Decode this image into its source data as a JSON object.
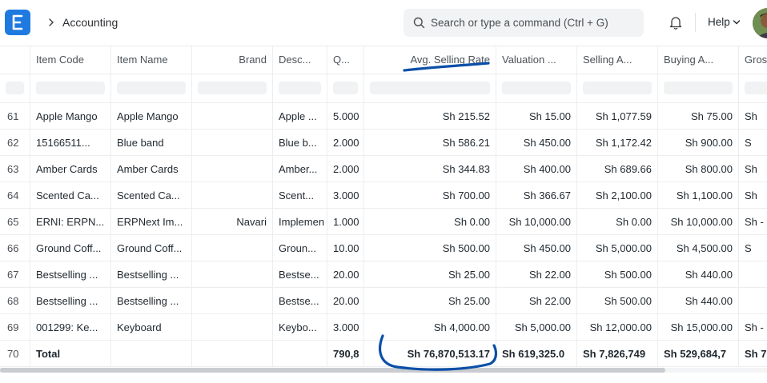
{
  "app": {
    "breadcrumb": "Accounting"
  },
  "search": {
    "placeholder": "Search or type a command (Ctrl + G)"
  },
  "help": {
    "label": "Help"
  },
  "colors": {
    "brand": "#1f7ae0",
    "annotation": "#0b4fa8"
  },
  "table": {
    "columns": [
      "Item Code",
      "Item Name",
      "Brand",
      "Desc...",
      "Q...",
      "Avg. Selling Rate",
      "Valuation ...",
      "Selling A...",
      "Buying A...",
      "Gros"
    ],
    "rows": [
      {
        "idx": "61",
        "code": "Apple Mango",
        "name": "Apple Mango",
        "brand": "",
        "desc": "Apple ...",
        "qty": "5.000",
        "avg": "Sh 215.52",
        "val": "Sh 15.00",
        "sell": "Sh 1,077.59",
        "buy": "Sh 75.00",
        "gross": "Sh"
      },
      {
        "idx": "62",
        "code": "15166511...",
        "name": "Blue band",
        "brand": "",
        "desc": "Blue b...",
        "qty": "2.000",
        "avg": "Sh 586.21",
        "val": "Sh 450.00",
        "sell": "Sh 1,172.42",
        "buy": "Sh 900.00",
        "gross": "S"
      },
      {
        "idx": "63",
        "code": "Amber Cards",
        "name": "Amber Cards",
        "brand": "",
        "desc": "Amber...",
        "qty": "2.000",
        "avg": "Sh 344.83",
        "val": "Sh 400.00",
        "sell": "Sh 689.66",
        "buy": "Sh 800.00",
        "gross": "Sh"
      },
      {
        "idx": "64",
        "code": "Scented Ca...",
        "name": "Scented Ca...",
        "brand": "",
        "desc": "Scent...",
        "qty": "3.000",
        "avg": "Sh 700.00",
        "val": "Sh 366.67",
        "sell": "Sh 2,100.00",
        "buy": "Sh 1,100.00",
        "gross": "Sh"
      },
      {
        "idx": "65",
        "code": "ERNI: ERPN...",
        "name": "ERPNext Im...",
        "brand": "Navari",
        "desc": "Implemen",
        "qty": "1.000",
        "avg": "Sh 0.00",
        "val": "Sh 10,000.00",
        "sell": "Sh 0.00",
        "buy": "Sh 10,000.00",
        "gross": "Sh -"
      },
      {
        "idx": "66",
        "code": "Ground Coff...",
        "name": "Ground Coff...",
        "brand": "",
        "desc": "Groun...",
        "qty": "10.00",
        "avg": "Sh 500.00",
        "val": "Sh 450.00",
        "sell": "Sh 5,000.00",
        "buy": "Sh 4,500.00",
        "gross": "S"
      },
      {
        "idx": "67",
        "code": "Bestselling ...",
        "name": "Bestselling ...",
        "brand": "",
        "desc": "Bestse...",
        "qty": "20.00",
        "avg": "Sh 25.00",
        "val": "Sh 22.00",
        "sell": "Sh 500.00",
        "buy": "Sh 440.00",
        "gross": ""
      },
      {
        "idx": "68",
        "code": "Bestselling ...",
        "name": "Bestselling ...",
        "brand": "",
        "desc": "Bestse...",
        "qty": "20.00",
        "avg": "Sh 25.00",
        "val": "Sh 22.00",
        "sell": "Sh 500.00",
        "buy": "Sh 440.00",
        "gross": ""
      },
      {
        "idx": "69",
        "code": "001299: Ke...",
        "name": "Keyboard",
        "brand": "",
        "desc": "Keybo...",
        "qty": "3.000",
        "avg": "Sh 4,000.00",
        "val": "Sh 5,000.00",
        "sell": "Sh 12,000.00",
        "buy": "Sh 15,000.00",
        "gross": "Sh -"
      }
    ],
    "total": {
      "idx": "70",
      "label": "Total",
      "qty": "790,8",
      "avg": "Sh 76,870,513.17",
      "val": "Sh 619,325.0",
      "sell": "Sh 7,826,749",
      "buy": "Sh 529,684,7",
      "gross": "Sh 7"
    }
  }
}
